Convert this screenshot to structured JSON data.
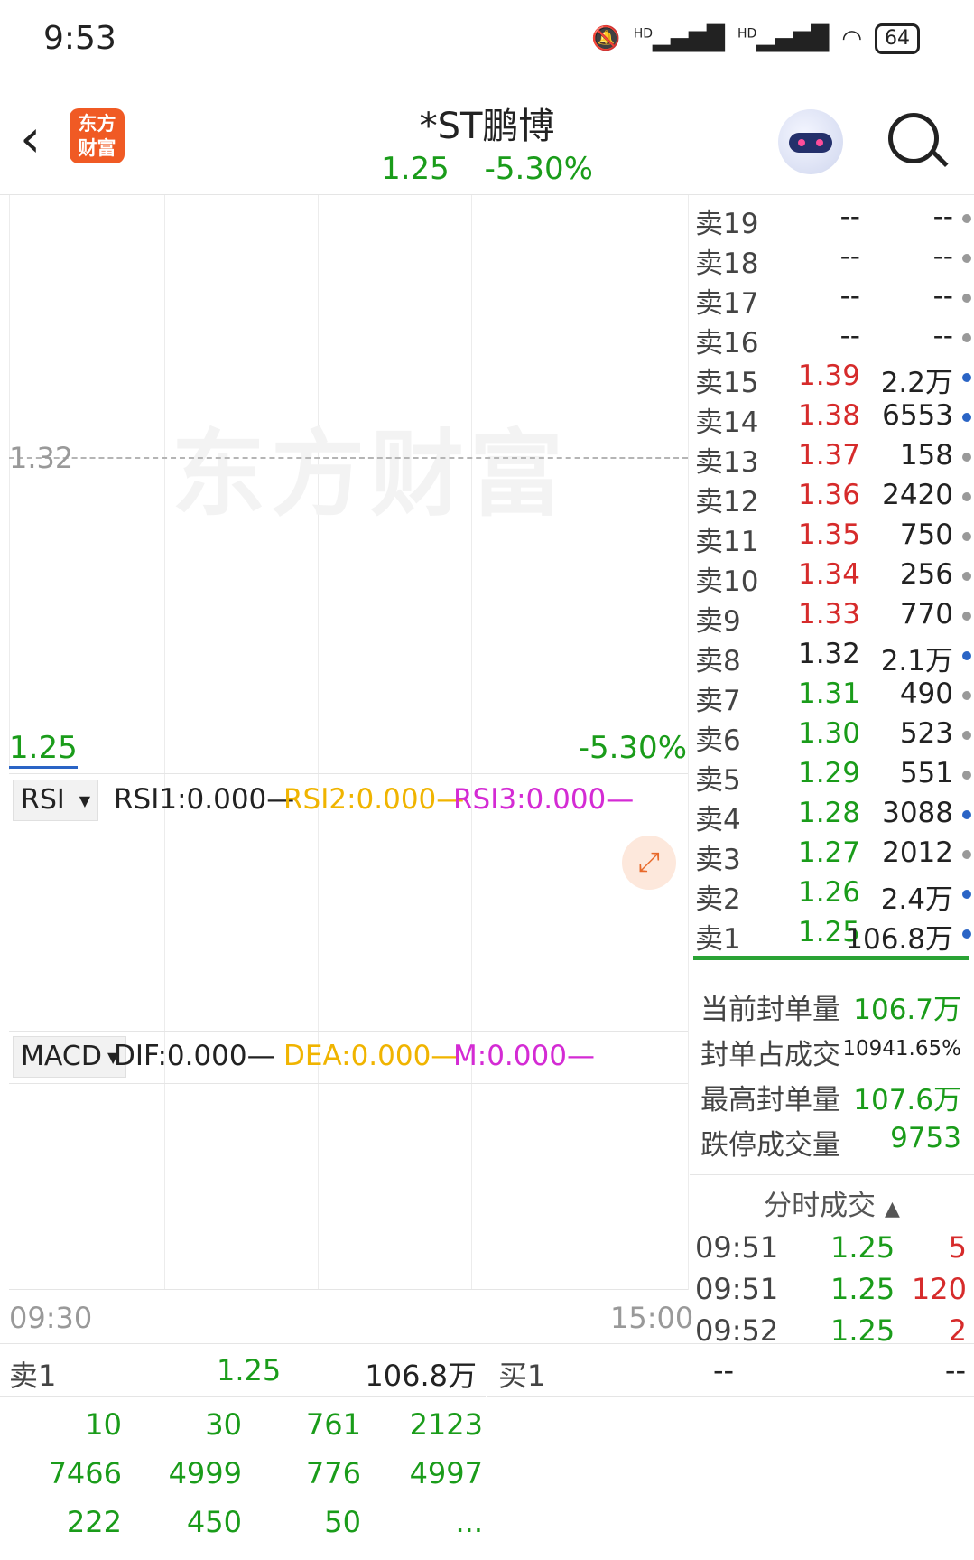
{
  "status_bar": {
    "time": "9:53",
    "signal1": "HD",
    "signal2": "HD",
    "battery": "64",
    "icons": [
      "mute-icon",
      "signal-icon",
      "signal-icon",
      "wifi-icon",
      "battery-icon"
    ]
  },
  "header": {
    "logo_text_line1": "东方",
    "logo_text_line2": "财富",
    "title": "*ST鹏博",
    "price": "1.25",
    "change_pct": "-5.30%"
  },
  "chart": {
    "watermark": "东方财富",
    "ref_price": "1.32",
    "low_price": "1.25",
    "low_pct": "-5.30%",
    "time_start": "09:30",
    "time_end": "15:00",
    "colors": {
      "up": "#d62b2b",
      "down": "#1a9c1a",
      "rsi2": "#f0b400",
      "rsi3": "#d42bd4"
    }
  },
  "rsi": {
    "selector": "RSI",
    "rsi1": "RSI1:0.000—",
    "rsi2": "RSI2:0.000—",
    "rsi3": "RSI3:0.000—"
  },
  "macd": {
    "selector": "MACD",
    "dif": "DIF:0.000—",
    "dea": "DEA:0.000—",
    "m": "M:0.000—"
  },
  "order_book": [
    {
      "label": "卖19",
      "price": "--",
      "volume": "--",
      "color": "#222",
      "dot": "#999"
    },
    {
      "label": "卖18",
      "price": "--",
      "volume": "--",
      "color": "#222",
      "dot": "#999"
    },
    {
      "label": "卖17",
      "price": "--",
      "volume": "--",
      "color": "#222",
      "dot": "#999"
    },
    {
      "label": "卖16",
      "price": "--",
      "volume": "--",
      "color": "#222",
      "dot": "#999"
    },
    {
      "label": "卖15",
      "price": "1.39",
      "volume": "2.2万",
      "color": "#d62b2b",
      "dot": "#2a64c5"
    },
    {
      "label": "卖14",
      "price": "1.38",
      "volume": "6553",
      "color": "#d62b2b",
      "dot": "#2a64c5"
    },
    {
      "label": "卖13",
      "price": "1.37",
      "volume": "158",
      "color": "#d62b2b",
      "dot": "#999"
    },
    {
      "label": "卖12",
      "price": "1.36",
      "volume": "2420",
      "color": "#d62b2b",
      "dot": "#999"
    },
    {
      "label": "卖11",
      "price": "1.35",
      "volume": "750",
      "color": "#d62b2b",
      "dot": "#999"
    },
    {
      "label": "卖10",
      "price": "1.34",
      "volume": "256",
      "color": "#d62b2b",
      "dot": "#999"
    },
    {
      "label": "卖9",
      "price": "1.33",
      "volume": "770",
      "color": "#d62b2b",
      "dot": "#999"
    },
    {
      "label": "卖8",
      "price": "1.32",
      "volume": "2.1万",
      "color": "#222",
      "dot": "#2a64c5"
    },
    {
      "label": "卖7",
      "price": "1.31",
      "volume": "490",
      "color": "#1a9c1a",
      "dot": "#999"
    },
    {
      "label": "卖6",
      "price": "1.30",
      "volume": "523",
      "color": "#1a9c1a",
      "dot": "#999"
    },
    {
      "label": "卖5",
      "price": "1.29",
      "volume": "551",
      "color": "#1a9c1a",
      "dot": "#999"
    },
    {
      "label": "卖4",
      "price": "1.28",
      "volume": "3088",
      "color": "#1a9c1a",
      "dot": "#2a64c5"
    },
    {
      "label": "卖3",
      "price": "1.27",
      "volume": "2012",
      "color": "#1a9c1a",
      "dot": "#999"
    },
    {
      "label": "卖2",
      "price": "1.26",
      "volume": "2.4万",
      "color": "#1a9c1a",
      "dot": "#2a64c5"
    },
    {
      "label": "卖1",
      "price": "1.25",
      "volume": "106.8万",
      "color": "#1a9c1a",
      "dot": "#2a64c5"
    }
  ],
  "seal": [
    {
      "key": "当前封单量",
      "value": "106.7万"
    },
    {
      "key": "封单占成交",
      "value": "10941.65%"
    },
    {
      "key": "最高封单量",
      "value": "107.6万"
    },
    {
      "key": "跌停成交量",
      "value": "9753"
    }
  ],
  "ticks": {
    "title": "分时成交",
    "rows": [
      {
        "time": "09:51",
        "price": "1.25",
        "qty": "5"
      },
      {
        "time": "09:51",
        "price": "1.25",
        "qty": "120"
      },
      {
        "time": "09:52",
        "price": "1.25",
        "qty": "2"
      }
    ]
  },
  "bottom": {
    "sell1_label": "卖1",
    "sell1_price": "1.25",
    "sell1_volume": "106.8万",
    "buy1_label": "买1",
    "buy1_price": "--",
    "buy1_volume": "--",
    "queue": [
      [
        "10",
        "30",
        "761",
        "2123"
      ],
      [
        "7466",
        "4999",
        "776",
        "4997"
      ],
      [
        "222",
        "450",
        "50",
        "..."
      ]
    ]
  }
}
